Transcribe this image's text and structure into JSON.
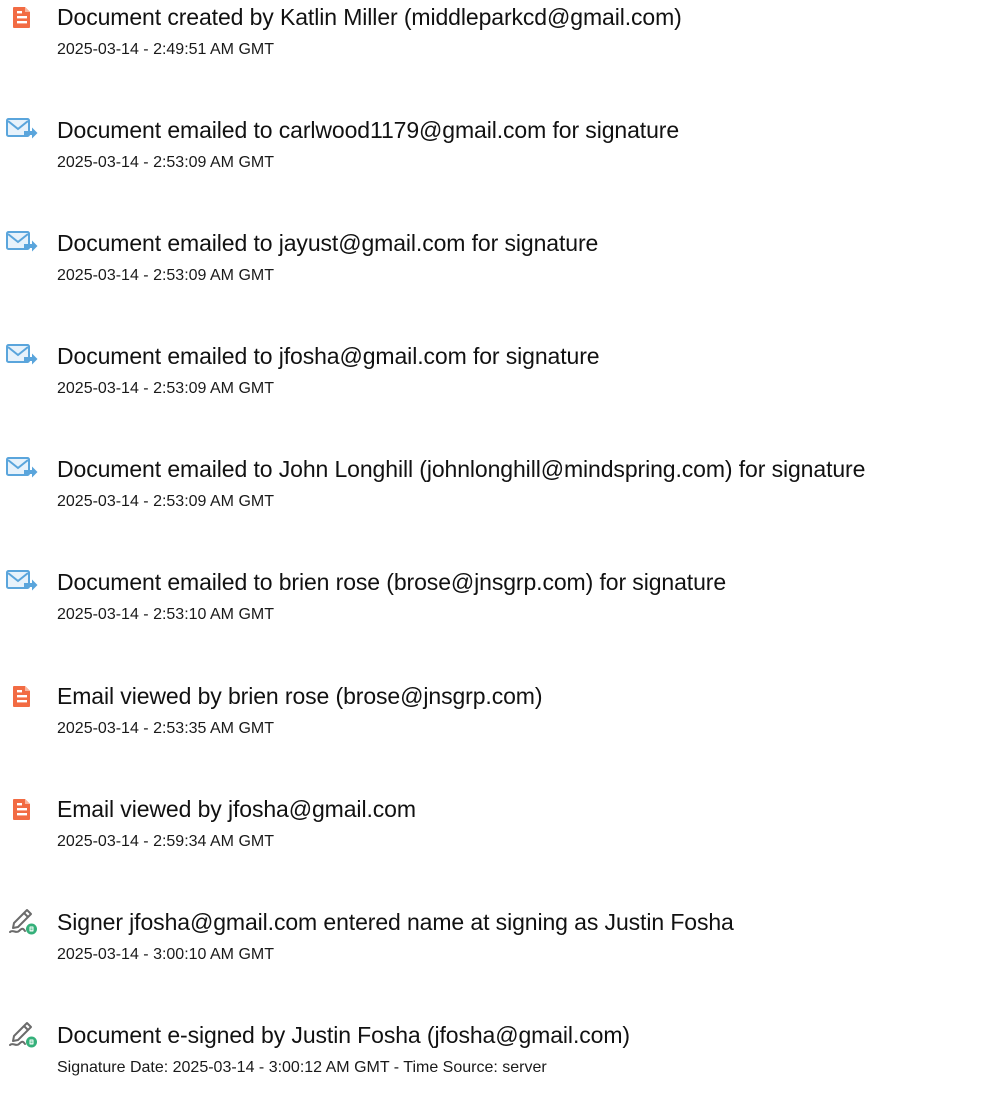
{
  "icon_colors": {
    "document": "#f26b43",
    "email": "#5aa5dc",
    "sign_pen": "#6b6b6b",
    "sign_badge": "#35b07a"
  },
  "events": [
    {
      "icon": "document-icon",
      "text": "Document created by Katlin Miller (middleparkcd@gmail.com)",
      "stamp": "2025-03-14 - 2:49:51 AM GMT"
    },
    {
      "icon": "email-forward-icon",
      "text": "Document emailed to carlwood1179@gmail.com for signature",
      "stamp": "2025-03-14 - 2:53:09 AM GMT"
    },
    {
      "icon": "email-forward-icon",
      "text": "Document emailed to jayust@gmail.com for signature",
      "stamp": "2025-03-14 - 2:53:09 AM GMT"
    },
    {
      "icon": "email-forward-icon",
      "text": "Document emailed to jfosha@gmail.com for signature",
      "stamp": "2025-03-14 - 2:53:09 AM GMT"
    },
    {
      "icon": "email-forward-icon",
      "text": "Document emailed to John Longhill (johnlonghill@mindspring.com) for signature",
      "stamp": "2025-03-14 - 2:53:09 AM GMT"
    },
    {
      "icon": "email-forward-icon",
      "text": "Document emailed to brien rose (brose@jnsgrp.com) for signature",
      "stamp": "2025-03-14 - 2:53:10 AM GMT"
    },
    {
      "icon": "document-icon",
      "text": "Email viewed by brien rose (brose@jnsgrp.com)",
      "stamp": "2025-03-14 - 2:53:35 AM GMT"
    },
    {
      "icon": "document-icon",
      "text": "Email viewed by jfosha@gmail.com",
      "stamp": "2025-03-14 - 2:59:34 AM GMT"
    },
    {
      "icon": "signature-pen-icon",
      "text": "Signer jfosha@gmail.com entered name at signing as Justin Fosha",
      "stamp": "2025-03-14 - 3:00:10 AM GMT"
    },
    {
      "icon": "signature-pen-icon",
      "text": "Document e-signed by Justin Fosha (jfosha@gmail.com)",
      "stamp": "Signature Date: 2025-03-14 - 3:00:12 AM GMT - Time Source: server"
    }
  ]
}
